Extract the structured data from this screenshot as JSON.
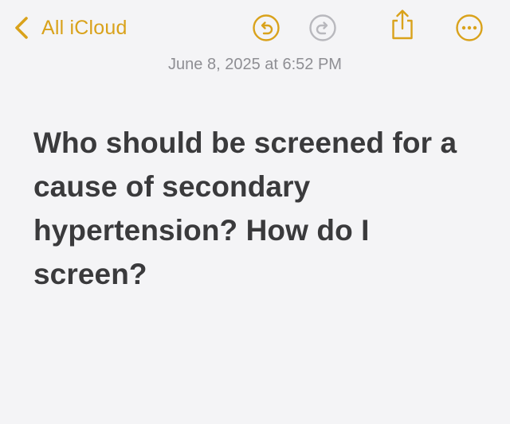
{
  "toolbar": {
    "back_label": "All iCloud",
    "icons": [
      "chevron-left-icon",
      "undo-icon",
      "redo-icon",
      "share-icon",
      "more-icon"
    ],
    "accent_color": "#d9a21b",
    "disabled_color": "#b8b8bd"
  },
  "note": {
    "date": "June 8, 2025 at 6:52 PM",
    "title": "Who should be screened for a cause of secondary hypertension? How do I screen?"
  }
}
